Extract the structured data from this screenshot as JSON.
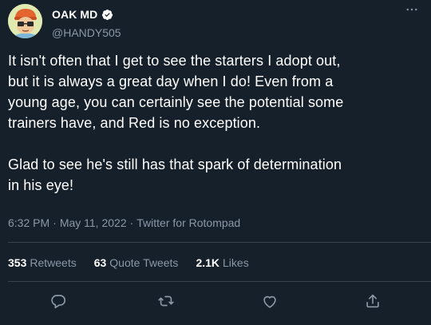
{
  "author": {
    "display_name": "OAK MD",
    "handle": "@HANDY505",
    "verified": true
  },
  "more_icon": "ellipsis-icon",
  "tweet": {
    "paragraphs": [
      "It isn't often that I get to see the starters I adopt out,\nbut it is always a great day when I do! Even from a\nyoung age, you can certainly see the potential some\ntrainers have, and Red is no exception.",
      "Glad to see he's still has that spark of determination\nin his eye!"
    ]
  },
  "meta": {
    "time": "6:32 PM",
    "date": "May 11, 2022",
    "source": "Twitter for Rotompad",
    "separator": "·"
  },
  "stats": {
    "retweets_count": "353",
    "retweets_label": "Retweets",
    "quotes_count": "63",
    "quotes_label": "Quote Tweets",
    "likes_count": "2.1K",
    "likes_label": "Likes"
  },
  "actions": {
    "reply_icon": "reply-icon",
    "retweet_icon": "retweet-icon",
    "like_icon": "heart-icon",
    "share_icon": "share-icon"
  },
  "colors": {
    "background": "#15202b",
    "text": "#ffffff",
    "secondary": "#8b98a5",
    "divider": "#38444d",
    "verified": "#ffffff"
  }
}
